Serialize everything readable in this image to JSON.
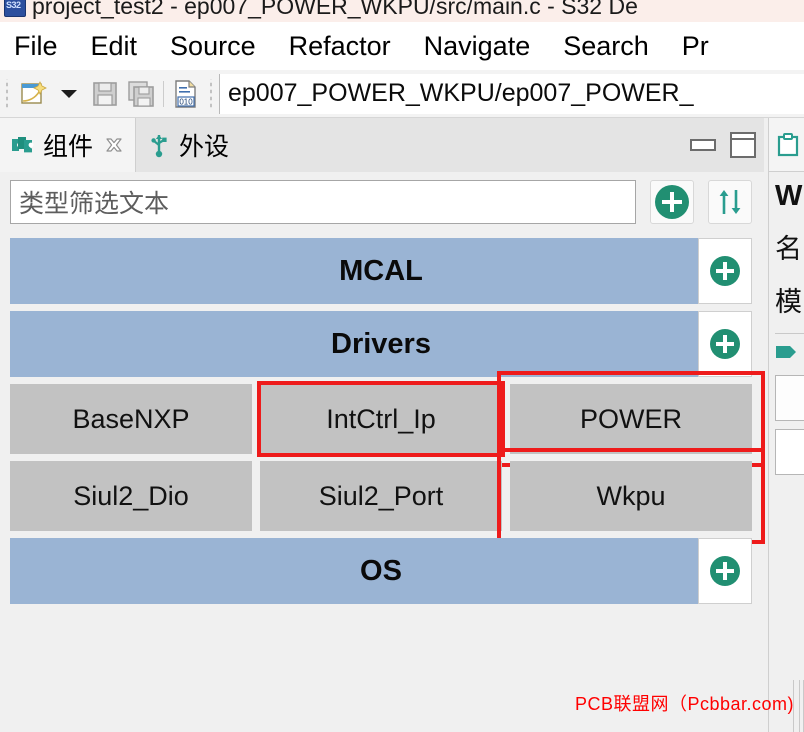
{
  "titlebar": {
    "app_icon": "s32ds-app-icon",
    "title": "project_test2 - ep007_POWER_WKPU/src/main.c - S32 De"
  },
  "menubar": {
    "items": [
      {
        "label": "File"
      },
      {
        "label": "Edit"
      },
      {
        "label": "Source"
      },
      {
        "label": "Refactor"
      },
      {
        "label": "Navigate"
      },
      {
        "label": "Search"
      },
      {
        "label": "Pr"
      }
    ]
  },
  "toolbar": {
    "new_icon": "new-file-icon",
    "dropdown_icon": "chevron-down-icon",
    "save_icon": "save-icon",
    "save_all_icon": "save-all-icon",
    "binary_icon": "binary-file-icon",
    "breadcrumb": "ep007_POWER_WKPU/ep007_POWER_"
  },
  "left_view": {
    "tabs": [
      {
        "label": "组件",
        "icon": "components-icon",
        "active": true,
        "close_icon": "close-icon"
      },
      {
        "label": "外设",
        "icon": "peripherals-usb-icon",
        "active": false
      }
    ],
    "controls": {
      "minimize": "minimize-icon",
      "maximize": "maximize-icon"
    },
    "filter": {
      "placeholder": "类型筛选文本",
      "value": "类型筛选文本",
      "add_icon": "add-component-icon",
      "sort_icon": "sort-arrows-icon"
    },
    "groups": [
      {
        "name": "MCAL",
        "add_icon": "add-icon",
        "rows": []
      },
      {
        "name": "Drivers",
        "add_icon": "add-icon",
        "rows": [
          [
            {
              "label": "BaseNXP",
              "highlighted": false
            },
            {
              "label": "IntCtrl_Ip",
              "highlighted": true
            },
            {
              "label": "POWER",
              "highlighted": true
            }
          ],
          [
            {
              "label": "Siul2_Dio",
              "highlighted": false
            },
            {
              "label": "Siul2_Port",
              "highlighted": false
            },
            {
              "label": "Wkpu",
              "highlighted": true
            }
          ]
        ]
      },
      {
        "name": "OS",
        "add_icon": "add-icon",
        "rows": []
      }
    ]
  },
  "right_panel": {
    "tab_icon": "overview-icon",
    "lines": [
      "W",
      "名",
      "模"
    ],
    "marker_icon": "tag-icon"
  },
  "watermark": {
    "text": "PCB联盟网（Pcbbar.com)",
    "color": "#ff0000"
  },
  "colors": {
    "group_header": "#9ab4d4",
    "tile": "#c2c2c2",
    "accent_green": "#218f72",
    "highlight_red": "#ee1b1b",
    "titlebar_bg": "#fbeeea"
  }
}
